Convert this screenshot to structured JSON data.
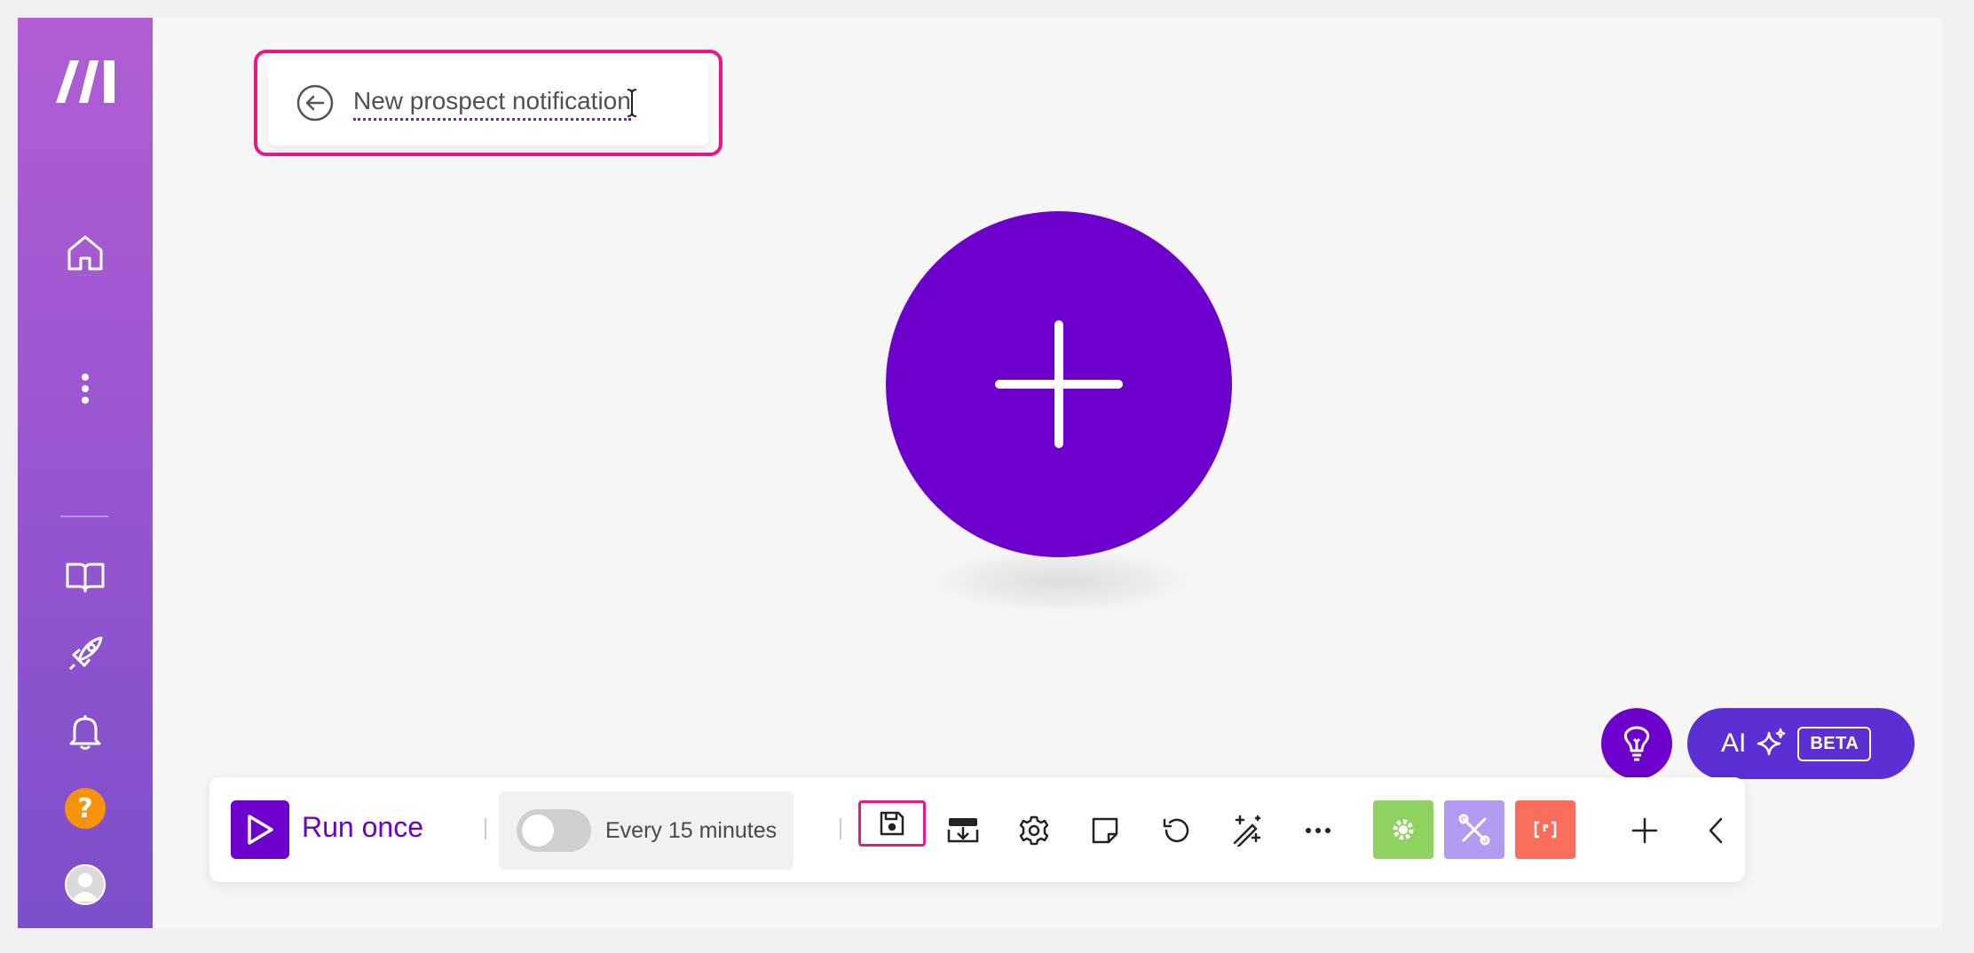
{
  "scenario": {
    "name": "New prospect notification"
  },
  "toolbar": {
    "run_label": "Run once",
    "schedule_label": "Every 15 minutes",
    "schedule_enabled": false
  },
  "ai": {
    "label": "AI",
    "badge": "BETA"
  },
  "sidebar": {
    "items": [
      "logo-icon",
      "home-icon",
      "more-vertical-icon",
      "book-icon",
      "rocket-icon",
      "bell-icon",
      "help-icon",
      "avatar"
    ],
    "help_label": "?"
  },
  "colors": {
    "brand": "#6d00cc",
    "highlight": "#e8178a",
    "flow_control": "#8fd262",
    "tools": "#b29bf0",
    "text_parser": "#f96e5b"
  }
}
